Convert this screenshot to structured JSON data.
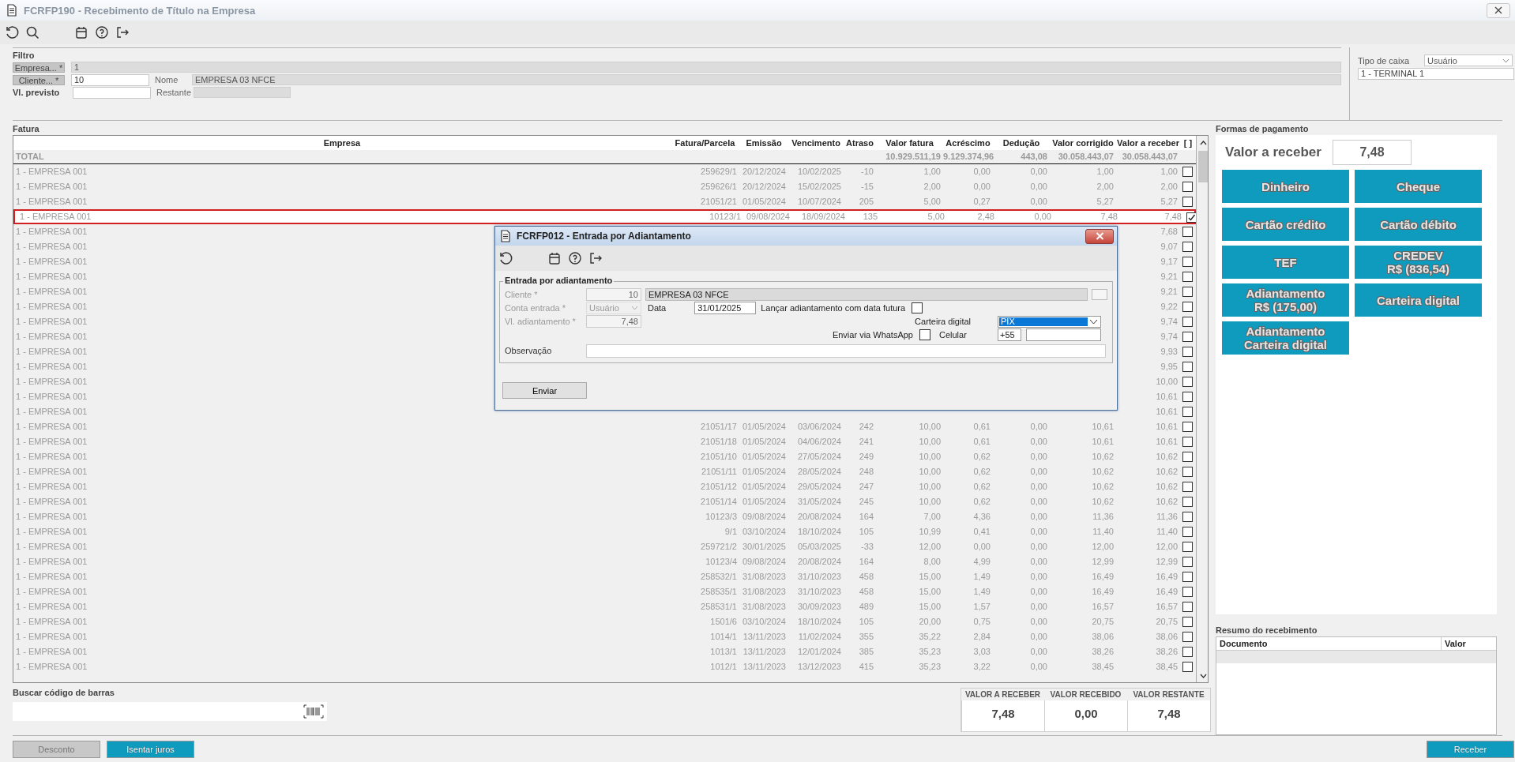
{
  "window": {
    "title": "FCRFP190 - Recebimento de Título na Empresa"
  },
  "filter": {
    "title": "Filtro",
    "empresa": {
      "label": "Empresa... *",
      "value": "1"
    },
    "cliente": {
      "label": "Cliente... *",
      "value": "10"
    },
    "nome": {
      "label": "Nome",
      "value": "EMPRESA 03 NFCE"
    },
    "vl_previsto": {
      "label": "Vl. previsto"
    },
    "restante": {
      "label": "Restante"
    },
    "tipo_caixa": {
      "label": "Tipo de caixa",
      "value": "Usuário"
    },
    "terminal": {
      "value": "1 - TERMINAL 1"
    }
  },
  "fatura": {
    "title": "Fatura",
    "columns": [
      "Empresa",
      "Fatura/Parcela",
      "Emissão",
      "Vencimento",
      "Atraso",
      "Valor fatura",
      "Acréscimo",
      "Dedução",
      "Valor corrigido",
      "Valor a receber",
      "[ ]"
    ],
    "total": {
      "label": "TOTAL",
      "valor_fatura": "10.929.511,19",
      "acrescimo": "9.129.374,96",
      "deducao": "443,08",
      "valor_corrigido": "30.058.443,07",
      "valor_a_receber": "30.058.443,07"
    },
    "rows": [
      {
        "empresa": "1 - EMPRESA 001",
        "fatura_parcela": "259629/1",
        "emissao": "20/12/2024",
        "vencimento": "10/02/2025",
        "atraso": "-10",
        "valor_fatura": "1,00",
        "acrescimo": "0,00",
        "deducao": "0,00",
        "valor_corrigido": "1,00",
        "valor_a_receber": "1,00",
        "checked": false,
        "selected": false
      },
      {
        "empresa": "1 - EMPRESA 001",
        "fatura_parcela": "259626/1",
        "emissao": "20/12/2024",
        "vencimento": "15/02/2025",
        "atraso": "-15",
        "valor_fatura": "2,00",
        "acrescimo": "0,00",
        "deducao": "0,00",
        "valor_corrigido": "2,00",
        "valor_a_receber": "2,00",
        "checked": false,
        "selected": false
      },
      {
        "empresa": "1 - EMPRESA 001",
        "fatura_parcela": "21051/21",
        "emissao": "01/05/2024",
        "vencimento": "10/07/2024",
        "atraso": "205",
        "valor_fatura": "5,00",
        "acrescimo": "0,27",
        "deducao": "0,00",
        "valor_corrigido": "5,27",
        "valor_a_receber": "5,27",
        "checked": false,
        "selected": false
      },
      {
        "empresa": "1 - EMPRESA 001",
        "fatura_parcela": "10123/1",
        "emissao": "09/08/2024",
        "vencimento": "18/09/2024",
        "atraso": "135",
        "valor_fatura": "5,00",
        "acrescimo": "2,48",
        "deducao": "0,00",
        "valor_corrigido": "7,48",
        "valor_a_receber": "7,48",
        "checked": true,
        "selected": true
      },
      {
        "empresa": "1 - EMPRESA 001",
        "valor_a_receber": "7,68",
        "checked": false,
        "selected": false
      },
      {
        "empresa": "1 - EMPRESA 001",
        "valor_a_receber": "9,07",
        "checked": false,
        "selected": false
      },
      {
        "empresa": "1 - EMPRESA 001",
        "valor_a_receber": "9,17",
        "checked": false,
        "selected": false
      },
      {
        "empresa": "1 - EMPRESA 001",
        "valor_a_receber": "9,21",
        "checked": false,
        "selected": false
      },
      {
        "empresa": "1 - EMPRESA 001",
        "valor_a_receber": "9,21",
        "checked": false,
        "selected": false
      },
      {
        "empresa": "1 - EMPRESA 001",
        "valor_a_receber": "9,22",
        "checked": false,
        "selected": false
      },
      {
        "empresa": "1 - EMPRESA 001",
        "valor_a_receber": "9,74",
        "checked": false,
        "selected": false
      },
      {
        "empresa": "1 - EMPRESA 001",
        "valor_a_receber": "9,74",
        "checked": false,
        "selected": false
      },
      {
        "empresa": "1 - EMPRESA 001",
        "valor_a_receber": "9,93",
        "checked": false,
        "selected": false
      },
      {
        "empresa": "1 - EMPRESA 001",
        "valor_a_receber": "9,95",
        "checked": false,
        "selected": false
      },
      {
        "empresa": "1 - EMPRESA 001",
        "valor_a_receber": "10,00",
        "checked": false,
        "selected": false
      },
      {
        "empresa": "1 - EMPRESA 001",
        "valor_a_receber": "10,61",
        "checked": false,
        "selected": false
      },
      {
        "empresa": "1 - EMPRESA 001",
        "valor_a_receber": "10,61",
        "checked": false,
        "selected": false
      },
      {
        "empresa": "1 - EMPRESA 001",
        "fatura_parcela": "21051/17",
        "emissao": "01/05/2024",
        "vencimento": "03/06/2024",
        "atraso": "242",
        "valor_fatura": "10,00",
        "acrescimo": "0,61",
        "deducao": "0,00",
        "valor_corrigido": "10,61",
        "valor_a_receber": "10,61",
        "checked": false,
        "selected": false
      },
      {
        "empresa": "1 - EMPRESA 001",
        "fatura_parcela": "21051/18",
        "emissao": "01/05/2024",
        "vencimento": "04/06/2024",
        "atraso": "241",
        "valor_fatura": "10,00",
        "acrescimo": "0,61",
        "deducao": "0,00",
        "valor_corrigido": "10,61",
        "valor_a_receber": "10,61",
        "checked": false,
        "selected": false
      },
      {
        "empresa": "1 - EMPRESA 001",
        "fatura_parcela": "21051/10",
        "emissao": "01/05/2024",
        "vencimento": "27/05/2024",
        "atraso": "249",
        "valor_fatura": "10,00",
        "acrescimo": "0,62",
        "deducao": "0,00",
        "valor_corrigido": "10,62",
        "valor_a_receber": "10,62",
        "checked": false,
        "selected": false
      },
      {
        "empresa": "1 - EMPRESA 001",
        "fatura_parcela": "21051/11",
        "emissao": "01/05/2024",
        "vencimento": "28/05/2024",
        "atraso": "248",
        "valor_fatura": "10,00",
        "acrescimo": "0,62",
        "deducao": "0,00",
        "valor_corrigido": "10,62",
        "valor_a_receber": "10,62",
        "checked": false,
        "selected": false
      },
      {
        "empresa": "1 - EMPRESA 001",
        "fatura_parcela": "21051/12",
        "emissao": "01/05/2024",
        "vencimento": "29/05/2024",
        "atraso": "247",
        "valor_fatura": "10,00",
        "acrescimo": "0,62",
        "deducao": "0,00",
        "valor_corrigido": "10,62",
        "valor_a_receber": "10,62",
        "checked": false,
        "selected": false
      },
      {
        "empresa": "1 - EMPRESA 001",
        "fatura_parcela": "21051/14",
        "emissao": "01/05/2024",
        "vencimento": "31/05/2024",
        "atraso": "245",
        "valor_fatura": "10,00",
        "acrescimo": "0,62",
        "deducao": "0,00",
        "valor_corrigido": "10,62",
        "valor_a_receber": "10,62",
        "checked": false,
        "selected": false
      },
      {
        "empresa": "1 - EMPRESA 001",
        "fatura_parcela": "10123/3",
        "emissao": "09/08/2024",
        "vencimento": "20/08/2024",
        "atraso": "164",
        "valor_fatura": "7,00",
        "acrescimo": "4,36",
        "deducao": "0,00",
        "valor_corrigido": "11,36",
        "valor_a_receber": "11,36",
        "checked": false,
        "selected": false
      },
      {
        "empresa": "1 - EMPRESA 001",
        "fatura_parcela": "9/1",
        "emissao": "03/10/2024",
        "vencimento": "18/10/2024",
        "atraso": "105",
        "valor_fatura": "10,99",
        "acrescimo": "0,41",
        "deducao": "0,00",
        "valor_corrigido": "11,40",
        "valor_a_receber": "11,40",
        "checked": false,
        "selected": false
      },
      {
        "empresa": "1 - EMPRESA 001",
        "fatura_parcela": "259721/2",
        "emissao": "30/01/2025",
        "vencimento": "05/03/2025",
        "atraso": "-33",
        "valor_fatura": "12,00",
        "acrescimo": "0,00",
        "deducao": "0,00",
        "valor_corrigido": "12,00",
        "valor_a_receber": "12,00",
        "checked": false,
        "selected": false
      },
      {
        "empresa": "1 - EMPRESA 001",
        "fatura_parcela": "10123/4",
        "emissao": "09/08/2024",
        "vencimento": "20/08/2024",
        "atraso": "164",
        "valor_fatura": "8,00",
        "acrescimo": "4,99",
        "deducao": "0,00",
        "valor_corrigido": "12,99",
        "valor_a_receber": "12,99",
        "checked": false,
        "selected": false
      },
      {
        "empresa": "1 - EMPRESA 001",
        "fatura_parcela": "258532/1",
        "emissao": "31/08/2023",
        "vencimento": "31/10/2023",
        "atraso": "458",
        "valor_fatura": "15,00",
        "acrescimo": "1,49",
        "deducao": "0,00",
        "valor_corrigido": "16,49",
        "valor_a_receber": "16,49",
        "checked": false,
        "selected": false
      },
      {
        "empresa": "1 - EMPRESA 001",
        "fatura_parcela": "258535/1",
        "emissao": "31/08/2023",
        "vencimento": "31/10/2023",
        "atraso": "458",
        "valor_fatura": "15,00",
        "acrescimo": "1,49",
        "deducao": "0,00",
        "valor_corrigido": "16,49",
        "valor_a_receber": "16,49",
        "checked": false,
        "selected": false
      },
      {
        "empresa": "1 - EMPRESA 001",
        "fatura_parcela": "258531/1",
        "emissao": "31/08/2023",
        "vencimento": "30/09/2023",
        "atraso": "489",
        "valor_fatura": "15,00",
        "acrescimo": "1,57",
        "deducao": "0,00",
        "valor_corrigido": "16,57",
        "valor_a_receber": "16,57",
        "checked": false,
        "selected": false
      },
      {
        "empresa": "1 - EMPRESA 001",
        "fatura_parcela": "1501/6",
        "emissao": "03/10/2024",
        "vencimento": "18/10/2024",
        "atraso": "105",
        "valor_fatura": "20,00",
        "acrescimo": "0,75",
        "deducao": "0,00",
        "valor_corrigido": "20,75",
        "valor_a_receber": "20,75",
        "checked": false,
        "selected": false
      },
      {
        "empresa": "1 - EMPRESA 001",
        "fatura_parcela": "1014/1",
        "emissao": "13/11/2023",
        "vencimento": "11/02/2024",
        "atraso": "355",
        "valor_fatura": "35,22",
        "acrescimo": "2,84",
        "deducao": "0,00",
        "valor_corrigido": "38,06",
        "valor_a_receber": "38,06",
        "checked": false,
        "selected": false
      },
      {
        "empresa": "1 - EMPRESA 001",
        "fatura_parcela": "1013/1",
        "emissao": "13/11/2023",
        "vencimento": "12/01/2024",
        "atraso": "385",
        "valor_fatura": "35,23",
        "acrescimo": "3,03",
        "deducao": "0,00",
        "valor_corrigido": "38,26",
        "valor_a_receber": "38,26",
        "checked": false,
        "selected": false
      },
      {
        "empresa": "1 - EMPRESA 001",
        "fatura_parcela": "1012/1",
        "emissao": "13/11/2023",
        "vencimento": "13/12/2023",
        "atraso": "415",
        "valor_fatura": "35,23",
        "acrescimo": "3,22",
        "deducao": "0,00",
        "valor_corrigido": "38,45",
        "valor_a_receber": "38,45",
        "checked": false,
        "selected": false
      }
    ]
  },
  "barcode": {
    "label": "Buscar código de barras"
  },
  "totals": [
    {
      "label": "VALOR A RECEBER",
      "value": "7,48"
    },
    {
      "label": "VALOR RECEBIDO",
      "value": "0,00"
    },
    {
      "label": "VALOR RESTANTE",
      "value": "7,48"
    }
  ],
  "payment": {
    "title": "Formas de pagamento",
    "amount_label": "Valor a receber",
    "amount": "7,48",
    "buttons": [
      "Dinheiro",
      "Cheque",
      "Cartão crédito",
      "Cartão débito",
      "TEF",
      "CREDEV\nR$ (836,54)",
      "Adiantamento\nR$ (175,00)",
      "Carteira digital",
      "Adiantamento\nCarteira digital"
    ]
  },
  "summary": {
    "title": "Resumo do recebimento",
    "columns": [
      "Documento",
      "Valor"
    ]
  },
  "actions": [
    {
      "label": "Desconto",
      "disabled": true
    },
    {
      "label": "Isentar juros",
      "disabled": false
    },
    {
      "label": "Receber",
      "disabled": false
    }
  ],
  "dialog": {
    "title": "FCRFP012 - Entrada por Adiantamento",
    "group": "Entrada por adiantamento",
    "cliente": {
      "label": "Cliente *",
      "value": "10",
      "name": "EMPRESA 03 NFCE",
      "disabled": true
    },
    "conta_entrada": {
      "label": "Conta entrada *",
      "value": "Usuário",
      "disabled": true
    },
    "vl_adiantamento": {
      "label": "Vl. adiantamento *",
      "value": "7,48",
      "disabled": true
    },
    "data": {
      "label": "Data",
      "value": "31/01/2025"
    },
    "lancar_futura": {
      "label": "Lançar adiantamento com data futura",
      "checked": false
    },
    "carteira": {
      "label": "Carteira digital",
      "value": "PIX"
    },
    "whatsapp": {
      "label": "Enviar via WhatsApp",
      "checked": false
    },
    "celular": {
      "label": "Celular",
      "ddi": "+55"
    },
    "observacao": {
      "label": "Observação"
    },
    "button": "Enviar"
  }
}
